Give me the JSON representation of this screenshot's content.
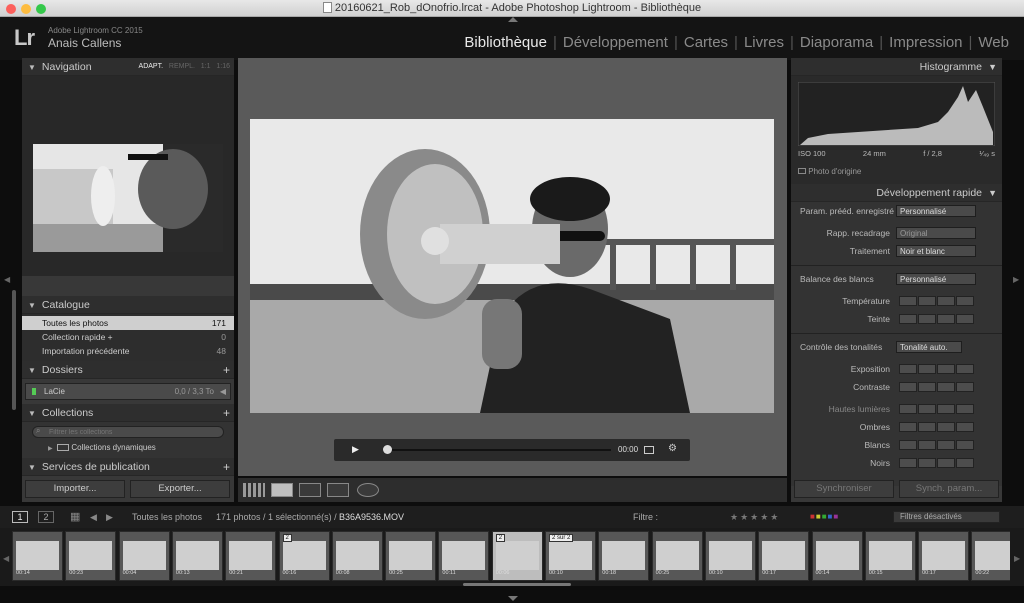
{
  "window": {
    "title": "20160621_Rob_dOnofrio.lrcat - Adobe Photoshop Lightroom - Bibliothèque"
  },
  "identity": {
    "logo": "Lr",
    "version": "Adobe Lightroom CC 2015",
    "user": "Anais Callens"
  },
  "modules": [
    "Bibliothèque",
    "Développement",
    "Cartes",
    "Livres",
    "Diaporama",
    "Impression",
    "Web"
  ],
  "navigation": {
    "title": "Navigation",
    "zoom_options": [
      "ADAPT.",
      "REMPL.",
      "1:1",
      "1:16"
    ]
  },
  "catalogue": {
    "title": "Catalogue",
    "items": [
      {
        "label": "Toutes les photos",
        "count": "171"
      },
      {
        "label": "Collection rapide +",
        "count": "0"
      },
      {
        "label": "Importation précédente",
        "count": "48"
      }
    ]
  },
  "folders": {
    "title": "Dossiers",
    "volume": "LaCie",
    "volume_size": "0,0 / 3,3 To"
  },
  "collections": {
    "title": "Collections",
    "filter_placeholder": "Filtrer les collections",
    "smart": "Collections dynamiques"
  },
  "publish": {
    "title": "Services de publication"
  },
  "left_buttons": {
    "import": "Importer...",
    "export": "Exporter..."
  },
  "video": {
    "time": "00:00"
  },
  "histogram": {
    "title": "Histogramme",
    "iso": "ISO 100",
    "focal": "24 mm",
    "aperture": "f / 2,8",
    "shutter": "¹⁄₄₉ s",
    "original": "Photo d'origine"
  },
  "quick_develop": {
    "title": "Développement rapide",
    "preset_label": "Param. prééd. enregistré",
    "preset_value": "Personnalisé",
    "crop_label": "Rapp. recadrage",
    "crop_value": "Original",
    "treatment_label": "Traitement",
    "treatment_value": "Noir et blanc",
    "wb_label": "Balance des blancs",
    "wb_value": "Personnalisé",
    "temperature": "Température",
    "tint": "Teinte",
    "tone_label": "Contrôle des tonalités",
    "auto_tone": "Tonalité auto.",
    "exposure": "Exposition",
    "contrast": "Contraste",
    "highlights": "Hautes lumières",
    "shadows": "Ombres",
    "whites": "Blancs",
    "blacks": "Noirs"
  },
  "right_buttons": {
    "sync": "Synchroniser",
    "sync_settings": "Synch. param..."
  },
  "filmbar": {
    "screen1": "1",
    "screen2": "2",
    "source": "Toutes les photos",
    "summary": "171 photos / 1 sélectionné(s) /",
    "filename": "B36A9536.MOV",
    "filter_label": "Filtre :",
    "filter_state": "Filtres désactivés"
  },
  "thumbnails": [
    {
      "label": "00:14"
    },
    {
      "label": "00:23"
    },
    {
      "label": "00:04"
    },
    {
      "label": "00:13"
    },
    {
      "label": "00:21"
    },
    {
      "label": "00:16",
      "badge": "2"
    },
    {
      "label": "00:08"
    },
    {
      "label": "00:25"
    },
    {
      "label": "00:11"
    },
    {
      "label": "00:06",
      "badge": "2",
      "selected": true
    },
    {
      "label": "00:10",
      "badge": "2 sur 2"
    },
    {
      "label": "00:18"
    },
    {
      "label": "00:25"
    },
    {
      "label": "00:10"
    },
    {
      "label": "00:17"
    },
    {
      "label": "00:14"
    },
    {
      "label": "00:15"
    },
    {
      "label": "00:17"
    },
    {
      "label": "00:22"
    }
  ]
}
